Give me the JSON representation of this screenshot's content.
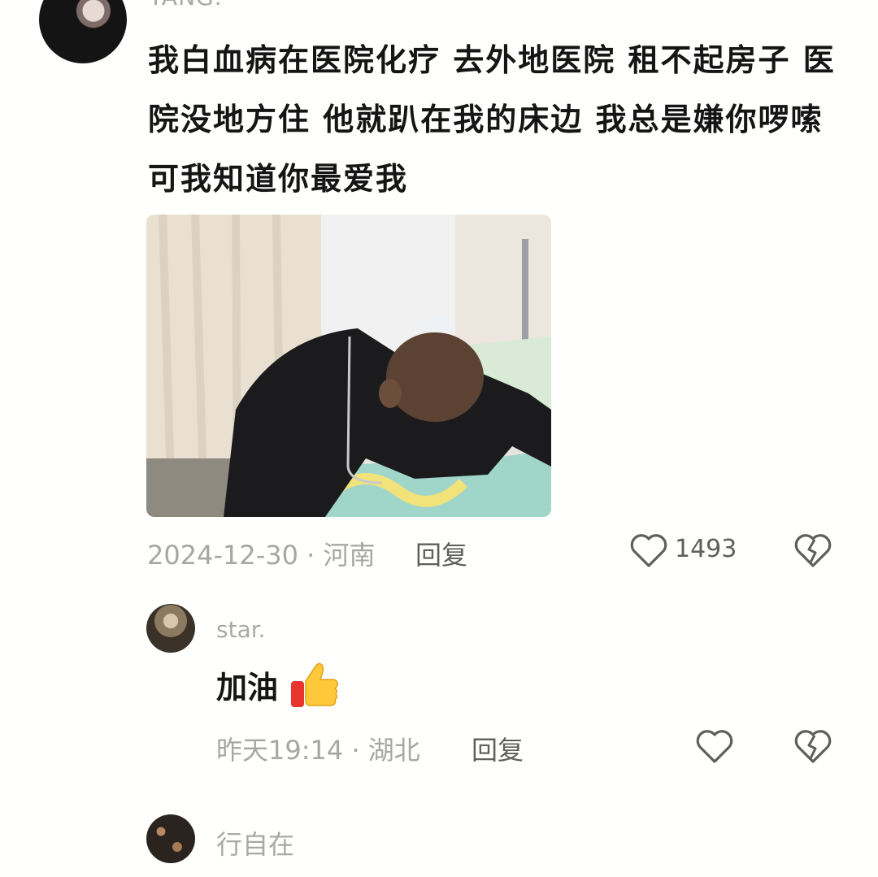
{
  "comments": [
    {
      "username": "YANG.",
      "text": "我白血病在医院化疗 去外地医院 租不起房子 医院没地方住 他就趴在我的床边 我总是嫌你啰嗦 可我知道你最爱我",
      "meta": "2024-12-30 · 河南",
      "reply_label": "回复",
      "like_count": "1493",
      "avatar_icon": "user-avatar",
      "image_icon": "photo-attachment"
    },
    {
      "username": "star.",
      "text": "加油",
      "emoji_icon": "thumbs-up-icon",
      "meta": "昨天19:14 · 湖北",
      "reply_label": "回复"
    },
    {
      "username": "行自在"
    }
  ],
  "icons": {
    "like": "heart-outline-icon",
    "dislike": "broken-heart-icon"
  },
  "colors": {
    "background": "#fffffd",
    "text_primary": "#151515",
    "text_meta": "#a6a6a6",
    "text_action": "#5e5e5e"
  }
}
